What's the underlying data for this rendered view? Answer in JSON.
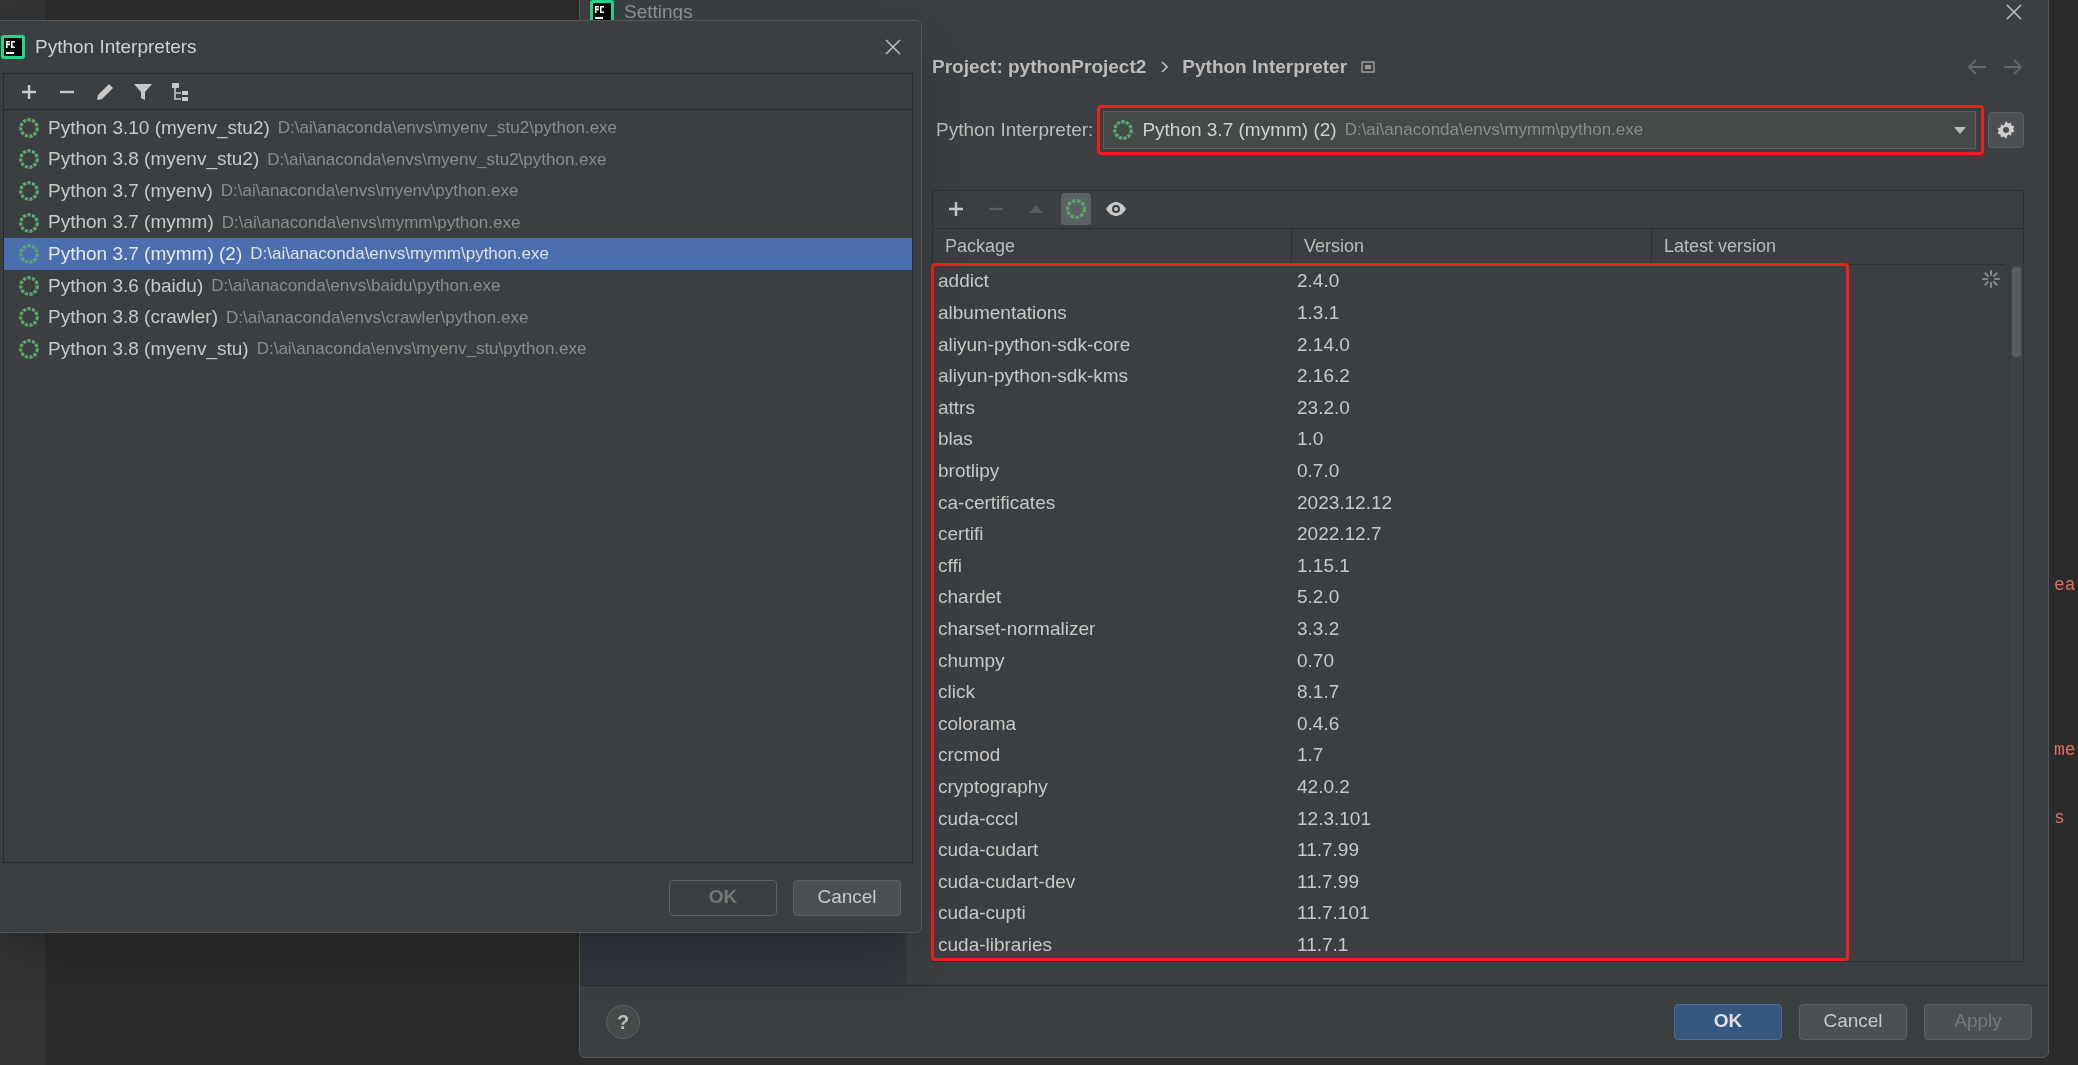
{
  "interpreters_dialog": {
    "title": "Python Interpreters",
    "toolbar": [
      {
        "kind": "add"
      },
      {
        "kind": "remove"
      },
      {
        "kind": "edit"
      },
      {
        "kind": "filter"
      },
      {
        "kind": "tree"
      }
    ],
    "interpreters": [
      {
        "name": "Python 3.10 (myenv_stu2)",
        "path": "D:\\ai\\anaconda\\envs\\myenv_stu2\\python.exe",
        "selected": false
      },
      {
        "name": "Python 3.8 (myenv_stu2)",
        "path": "D:\\ai\\anaconda\\envs\\myenv_stu2\\python.exe",
        "selected": false
      },
      {
        "name": "Python 3.7 (myenv)",
        "path": "D:\\ai\\anaconda\\envs\\myenv\\python.exe",
        "selected": false
      },
      {
        "name": "Python 3.7 (mymm)",
        "path": "D:\\ai\\anaconda\\envs\\mymm\\python.exe",
        "selected": false
      },
      {
        "name": "Python 3.7 (mymm) (2)",
        "path": "D:\\ai\\anaconda\\envs\\mymm\\python.exe",
        "selected": true
      },
      {
        "name": "Python 3.6 (baidu)",
        "path": "D:\\ai\\anaconda\\envs\\baidu\\python.exe",
        "selected": false
      },
      {
        "name": "Python 3.8 (crawler)",
        "path": "D:\\ai\\anaconda\\envs\\crawler\\python.exe",
        "selected": false
      },
      {
        "name": "Python 3.8 (myenv_stu)",
        "path": "D:\\ai\\anaconda\\envs\\myenv_stu\\python.exe",
        "selected": false
      }
    ],
    "buttons": [
      {
        "label": "OK",
        "disabled": true
      },
      {
        "label": "Cancel",
        "disabled": false
      }
    ]
  },
  "settings": {
    "title": "Settings",
    "breadcrumb": [
      "Project: pythonProject2",
      "Python Interpreter"
    ],
    "interpreter_label": "Python Interpreter:",
    "interpreter": {
      "name": "Python 3.7 (mymm) (2)",
      "path": "D:\\ai\\anaconda\\envs\\mymm\\python.exe"
    },
    "package_toolbar": [
      {
        "kind": "add",
        "disabled": false,
        "selected": false
      },
      {
        "kind": "remove",
        "disabled": true,
        "selected": false
      },
      {
        "kind": "upgrade",
        "disabled": true,
        "selected": false
      },
      {
        "kind": "conda",
        "disabled": false,
        "selected": true
      },
      {
        "kind": "eye",
        "disabled": false,
        "selected": false
      }
    ],
    "packages": {
      "columns": [
        "Package",
        "Version",
        "Latest version"
      ],
      "rows": [
        {
          "name": "addict",
          "version": "2.4.0"
        },
        {
          "name": "albumentations",
          "version": "1.3.1"
        },
        {
          "name": "aliyun-python-sdk-core",
          "version": "2.14.0"
        },
        {
          "name": "aliyun-python-sdk-kms",
          "version": "2.16.2"
        },
        {
          "name": "attrs",
          "version": "23.2.0"
        },
        {
          "name": "blas",
          "version": "1.0"
        },
        {
          "name": "brotlipy",
          "version": "0.7.0"
        },
        {
          "name": "ca-certificates",
          "version": "2023.12.12"
        },
        {
          "name": "certifi",
          "version": "2022.12.7"
        },
        {
          "name": "cffi",
          "version": "1.15.1"
        },
        {
          "name": "chardet",
          "version": "5.2.0"
        },
        {
          "name": "charset-normalizer",
          "version": "3.3.2"
        },
        {
          "name": "chumpy",
          "version": "0.70"
        },
        {
          "name": "click",
          "version": "8.1.7"
        },
        {
          "name": "colorama",
          "version": "0.4.6"
        },
        {
          "name": "crcmod",
          "version": "1.7"
        },
        {
          "name": "cryptography",
          "version": "42.0.2"
        },
        {
          "name": "cuda-cccl",
          "version": "12.3.101"
        },
        {
          "name": "cuda-cudart",
          "version": "11.7.99"
        },
        {
          "name": "cuda-cudart-dev",
          "version": "11.7.99"
        },
        {
          "name": "cuda-cupti",
          "version": "11.7.101"
        },
        {
          "name": "cuda-libraries",
          "version": "11.7.1"
        }
      ]
    },
    "help_label": "?",
    "buttons": [
      {
        "label": "OK",
        "kind": "primary",
        "disabled": false
      },
      {
        "label": "Cancel",
        "kind": "normal",
        "disabled": false
      },
      {
        "label": "Apply",
        "kind": "normal",
        "disabled": true
      }
    ]
  },
  "editor_fragments": [
    "ea",
    "me",
    "s"
  ]
}
